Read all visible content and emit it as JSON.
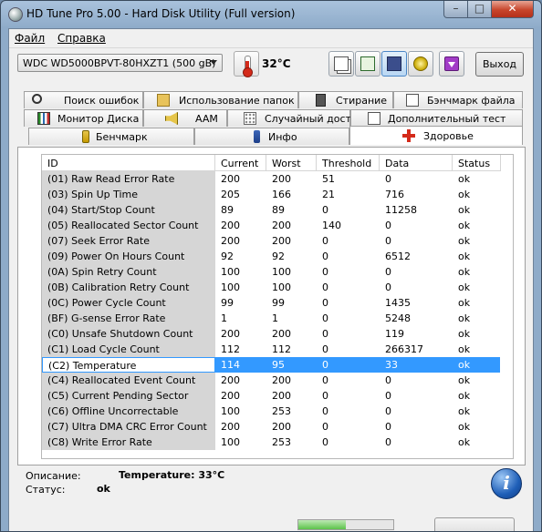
{
  "window": {
    "title": "HD Tune Pro 5.00 - Hard Disk Utility (Full  version)"
  },
  "menu": {
    "file": "Файл",
    "help": "Справка"
  },
  "toolbar": {
    "drive": "WDC WD5000BPVT-80HXZT1 (500 gB)",
    "temperature": "32°C",
    "exit_label": "Выход"
  },
  "tabs_row1": [
    "Поиск ошибок",
    "Использование папок",
    "Стирание",
    "Бэнчмарк файла"
  ],
  "tabs_row2": [
    "Монитор Диска",
    "AAM",
    "Случайный доступ",
    "Дополнительный  тест"
  ],
  "tabs_row3": [
    "Бенчмарк",
    "Инфо",
    "Здоровье"
  ],
  "active_tab": "Здоровье",
  "table": {
    "headers": [
      "ID",
      "Current",
      "Worst",
      "Threshold",
      "Data",
      "Status"
    ],
    "rows": [
      [
        "(01) Raw Read Error Rate",
        "200",
        "200",
        "51",
        "0",
        "ok"
      ],
      [
        "(03) Spin Up Time",
        "205",
        "166",
        "21",
        "716",
        "ok"
      ],
      [
        "(04) Start/Stop Count",
        "89",
        "89",
        "0",
        "11258",
        "ok"
      ],
      [
        "(05) Reallocated Sector Count",
        "200",
        "200",
        "140",
        "0",
        "ok"
      ],
      [
        "(07) Seek Error Rate",
        "200",
        "200",
        "0",
        "0",
        "ok"
      ],
      [
        "(09) Power On Hours Count",
        "92",
        "92",
        "0",
        "6512",
        "ok"
      ],
      [
        "(0A) Spin Retry Count",
        "100",
        "100",
        "0",
        "0",
        "ok"
      ],
      [
        "(0B) Calibration Retry Count",
        "100",
        "100",
        "0",
        "0",
        "ok"
      ],
      [
        "(0C) Power Cycle Count",
        "99",
        "99",
        "0",
        "1435",
        "ok"
      ],
      [
        "(BF) G-sense Error Rate",
        "1",
        "1",
        "0",
        "5248",
        "ok"
      ],
      [
        "(C0) Unsafe Shutdown Count",
        "200",
        "200",
        "0",
        "119",
        "ok"
      ],
      [
        "(C1) Load Cycle Count",
        "112",
        "112",
        "0",
        "266317",
        "ok"
      ],
      [
        "(C2) Temperature",
        "114",
        "95",
        "0",
        "33",
        "ok"
      ],
      [
        "(C4) Reallocated Event Count",
        "200",
        "200",
        "0",
        "0",
        "ok"
      ],
      [
        "(C5) Current Pending Sector",
        "200",
        "200",
        "0",
        "0",
        "ok"
      ],
      [
        "(C6) Offline Uncorrectable",
        "100",
        "253",
        "0",
        "0",
        "ok"
      ],
      [
        "(C7) Ultra DMA CRC Error Count",
        "200",
        "200",
        "0",
        "0",
        "ok"
      ],
      [
        "(C8) Write Error Rate",
        "100",
        "253",
        "0",
        "0",
        "ok"
      ]
    ],
    "selected_row": 12
  },
  "details": {
    "description_label": "Описание:",
    "description_value": "Temperature: 33°C",
    "status_label": "Статус:",
    "status_value": "ok"
  },
  "progress_fraction": 0.5,
  "colors": {
    "selection": "#3399ff",
    "close_button": "#c7452b",
    "health_icon": "#d42a1a"
  }
}
